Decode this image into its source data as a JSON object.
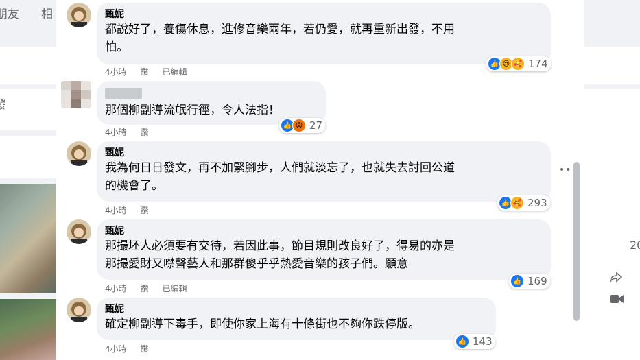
{
  "background": {
    "nav_left_1": "朋友",
    "nav_left_2": "相",
    "left_char": "發",
    "right_number": "20"
  },
  "comments": [
    {
      "author": "甄妮",
      "lines": [
        "都說好了，養傷休息，進修音樂兩年，若仍愛，就再重新出發，不用",
        "怕。"
      ],
      "time": "4小時",
      "reply": "讚",
      "edited": "已編輯",
      "reaction_icons": [
        "like-icon",
        "sad-icon",
        "care-icon"
      ],
      "reaction_count": "174"
    },
    {
      "author": "",
      "lines": [
        "那個柳副導流氓行徑，令人法指！"
      ],
      "time": "4小時",
      "reply": "讚",
      "edited": "",
      "reaction_icons": [
        "like-icon",
        "angry-icon"
      ],
      "reaction_count": "27"
    },
    {
      "author": "甄妮",
      "lines": [
        "我為何日日發文，再不加緊腳步，人們就淡忘了，也就失去討回公道",
        "的機會了。"
      ],
      "time": "4小時",
      "reply": "讚",
      "edited": "",
      "reaction_icons": [
        "like-icon",
        "care-icon"
      ],
      "reaction_count": "293"
    },
    {
      "author": "甄妮",
      "lines": [
        "那撮坯人必須要有交待，若因此事，節目規則改良好了，得易的亦是",
        "那撮愛財又噤聲藝人和那群傻乎乎熱愛音樂的孩子們。願意"
      ],
      "time": "4小時",
      "reply": "讚",
      "edited": "已編輯",
      "reaction_icons": [
        "like-icon"
      ],
      "reaction_count": "169"
    },
    {
      "author": "甄妮",
      "lines": [
        "確定柳副導下毒手，即使你家上海有十條街也不夠你跌停版。"
      ],
      "time": "4小時",
      "reply": "讚",
      "edited": "",
      "reaction_icons": [
        "like-icon"
      ],
      "reaction_count": "143"
    }
  ]
}
